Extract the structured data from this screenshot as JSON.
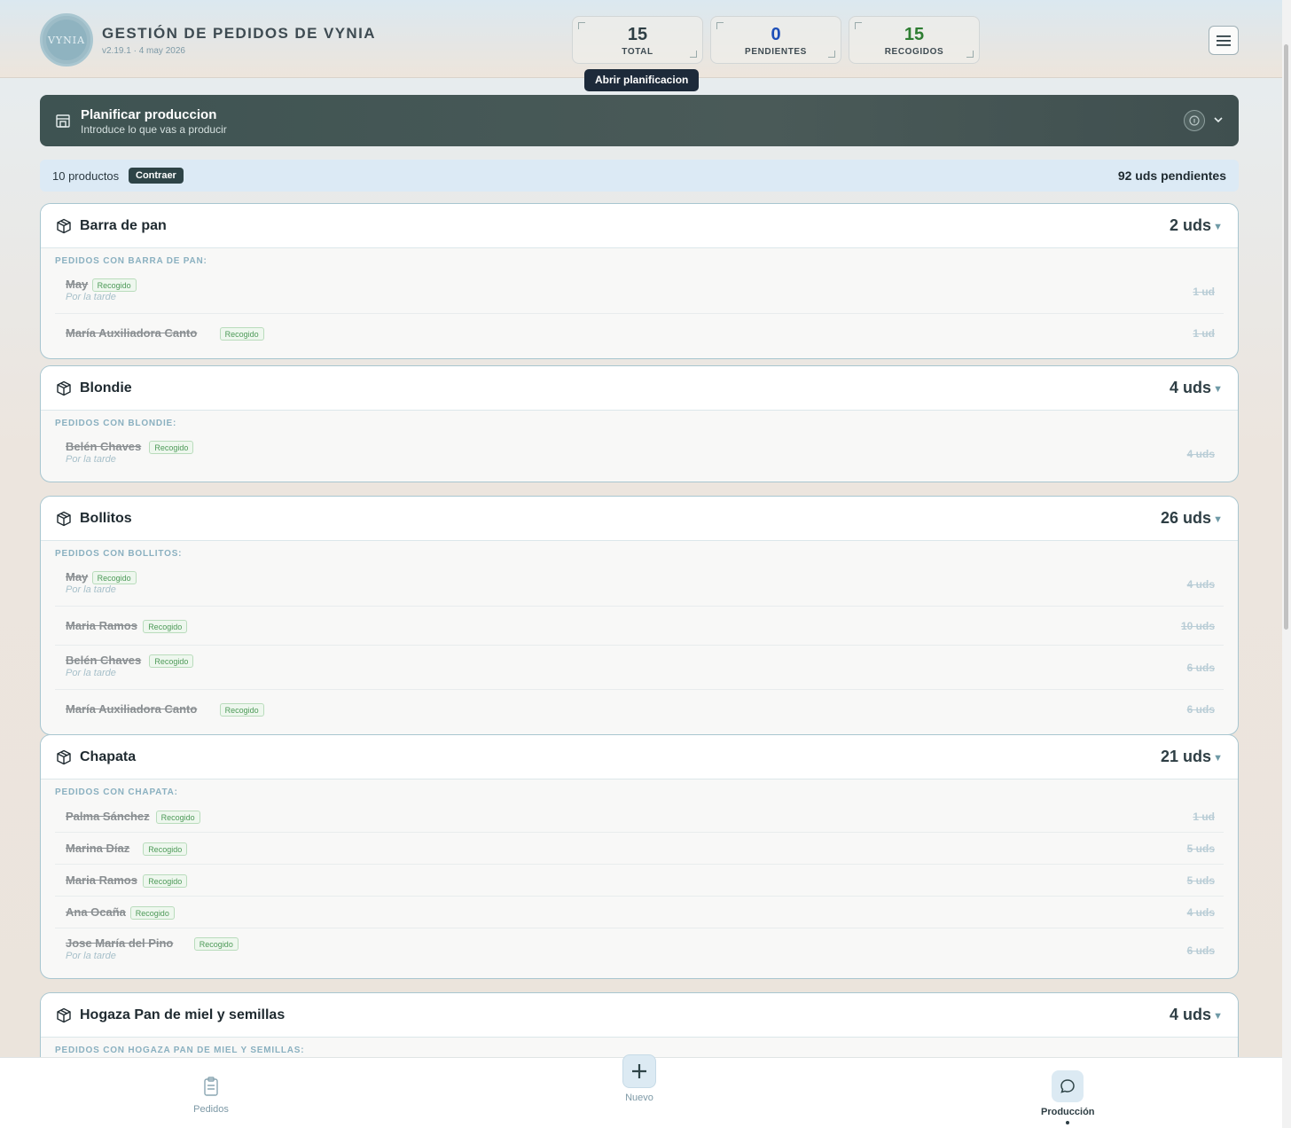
{
  "header": {
    "logo_text": "VYNIA",
    "title": "GESTIÓN DE PEDIDOS DE VYNIA",
    "version": "v2.19.1 · 4 may 2026",
    "stats": [
      {
        "value": "15",
        "label": "TOTAL",
        "color": "#2e3e44"
      },
      {
        "value": "0",
        "label": "PENDIENTES",
        "color": "#1d4fb8"
      },
      {
        "value": "15",
        "label": "RECOGIDOS",
        "color": "#2e7d32"
      }
    ],
    "tooltip": "Abrir planificacion"
  },
  "plan": {
    "title": "Planificar produccion",
    "subtitle": "Introduce lo que vas a producir"
  },
  "summary": {
    "count": "10 productos",
    "collapse_label": "Contraer",
    "pending": "92 uds pendientes"
  },
  "products": [
    {
      "name": "Barra de pan",
      "qty": "2 uds",
      "section": "PEDIDOS CON BARRA DE PAN:",
      "orders": [
        {
          "customer": "May",
          "status": "Recogido",
          "note": "Por la tarde",
          "uds": "1 ud"
        },
        {
          "customer": "María Auxiliadora Canto",
          "status": "Recogido",
          "note": "",
          "uds": "1 ud"
        }
      ]
    },
    {
      "name": "Blondie",
      "qty": "4 uds",
      "section": "PEDIDOS CON BLONDIE:",
      "orders": [
        {
          "customer": "Belén Chaves",
          "status": "Recogido",
          "note": "Por la tarde",
          "uds": "4 uds"
        }
      ]
    },
    {
      "name": "Bollitos",
      "qty": "26 uds",
      "section": "PEDIDOS CON BOLLITOS:",
      "orders": [
        {
          "customer": "May",
          "status": "Recogido",
          "note": "Por la tarde",
          "uds": "4 uds"
        },
        {
          "customer": "Maria Ramos",
          "status": "Recogido",
          "note": "",
          "uds": "10 uds"
        },
        {
          "customer": "Belén Chaves",
          "status": "Recogido",
          "note": "Por la tarde",
          "uds": "6 uds"
        },
        {
          "customer": "María Auxiliadora Canto",
          "status": "Recogido",
          "note": "",
          "uds": "6 uds"
        }
      ]
    },
    {
      "name": "Chapata",
      "qty": "21 uds",
      "section": "PEDIDOS CON CHAPATA:",
      "orders": [
        {
          "customer": "Palma Sánchez",
          "status": "Recogido",
          "note": "",
          "uds": "1 ud"
        },
        {
          "customer": "Marina Díaz",
          "status": "Recogido",
          "note": "",
          "uds": "5 uds"
        },
        {
          "customer": "Maria Ramos",
          "status": "Recogido",
          "note": "",
          "uds": "5 uds"
        },
        {
          "customer": "Ana Ocaña",
          "status": "Recogido",
          "note": "",
          "uds": "4 uds"
        },
        {
          "customer": "Jose María del Pino",
          "status": "Recogido",
          "note": "Por la tarde",
          "uds": "6 uds"
        }
      ]
    },
    {
      "name": "Hogaza Pan de miel y semillas",
      "qty": "4 uds",
      "section": "PEDIDOS CON HOGAZA PAN DE MIEL Y SEMILLAS:",
      "orders": []
    }
  ],
  "bottom_nav": {
    "pedidos": "Pedidos",
    "nuevo": "Nuevo",
    "produccion": "Producción"
  }
}
